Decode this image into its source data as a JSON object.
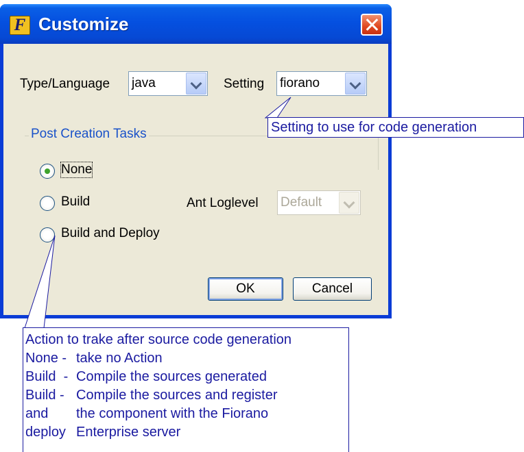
{
  "window": {
    "title": "Customize",
    "app_icon": "F"
  },
  "type_language": {
    "label": "Type/Language",
    "value": "java"
  },
  "setting": {
    "label": "Setting",
    "value": "fiorano"
  },
  "setting_tooltip": "Setting to use for code generation",
  "post_creation": {
    "title": "Post Creation Tasks",
    "options": [
      {
        "label": "None",
        "selected": true
      },
      {
        "label": "Build",
        "selected": false
      },
      {
        "label": "Build and Deploy",
        "selected": false
      }
    ],
    "ant_loglevel": {
      "label": "Ant Loglevel",
      "value": "Default",
      "disabled": true
    }
  },
  "buttons": {
    "ok": "OK",
    "cancel": "Cancel"
  },
  "action_tooltip": {
    "heading": "Action to trake after source code generation",
    "rows": [
      {
        "key": "None -",
        "text": "take no Action"
      },
      {
        "key": "Build  -",
        "text": "Compile the sources generated"
      },
      {
        "key": "Build -",
        "text": "Compile the sources and register"
      },
      {
        "key": "and",
        "text": "the component with the Fiorano"
      },
      {
        "key": "deploy",
        "text": "Enterprise server"
      }
    ]
  },
  "colors": {
    "titlebar": "#0550e0",
    "dialog_bg": "#ece9d8",
    "group_title": "#1a52c9",
    "tooltip_text": "#1a1aa0",
    "radio_dot": "#3fa32c"
  }
}
